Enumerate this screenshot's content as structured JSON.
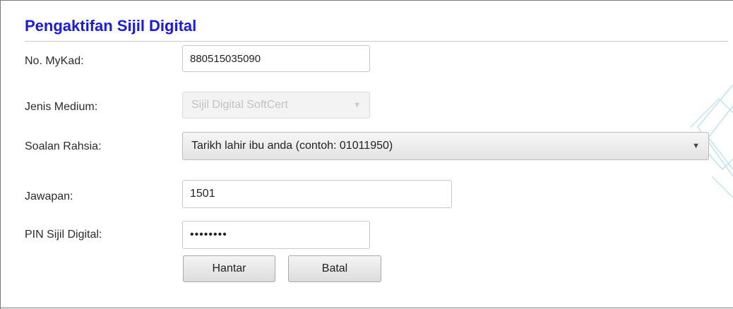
{
  "form": {
    "title": "Pengaktifan Sijil Digital",
    "mykad_label": "No. MyKad:",
    "mykad_value": "880515035090",
    "medium_label": "Jenis Medium:",
    "medium_value": "Sijil Digital SoftCert",
    "question_label": "Soalan Rahsia:",
    "question_value": "Tarikh lahir ibu anda (contoh: 01011950)",
    "answer_label": "Jawapan:",
    "answer_value": "1501",
    "pin_label": "PIN Sijil Digital:",
    "pin_value": "••••••••",
    "submit_label": "Hantar",
    "cancel_label": "Batal"
  },
  "icons": {
    "dropdown": "chevron-down-icon"
  },
  "colors": {
    "title": "#1a1ae6"
  }
}
